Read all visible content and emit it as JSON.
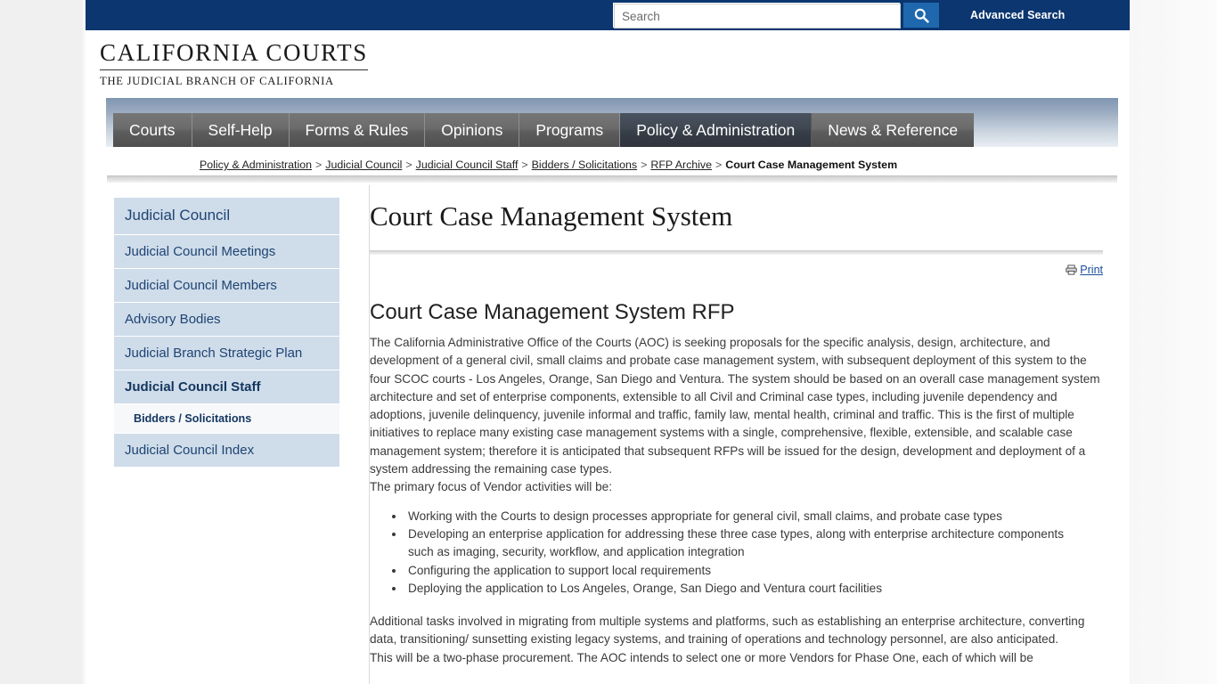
{
  "topbar": {
    "search_placeholder": "Search",
    "search_value": "",
    "search_icon": "search-icon",
    "advanced_search": "Advanced Search",
    "bar_color": "#0b3670",
    "button_color": "#1f68ad"
  },
  "logo": {
    "main": "CALIFORNIA COURTS",
    "sub": "THE JUDICIAL BRANCH OF CALIFORNIA"
  },
  "nav": {
    "tabs": [
      {
        "label": "Courts",
        "active": false
      },
      {
        "label": "Self-Help",
        "active": false
      },
      {
        "label": "Forms & Rules",
        "active": false
      },
      {
        "label": "Opinions",
        "active": false
      },
      {
        "label": "Programs",
        "active": false
      },
      {
        "label": "Policy & Administration",
        "active": true
      },
      {
        "label": "News & Reference",
        "active": false
      }
    ]
  },
  "breadcrumb": {
    "items": [
      "Policy & Administration",
      "Judicial Council",
      "Judicial Council Staff",
      "Bidders / Solicitations",
      "RFP Archive"
    ],
    "separator": ">",
    "current": "Court Case Management System"
  },
  "sidebar": {
    "items": [
      {
        "label": "Judicial Council",
        "type": "head"
      },
      {
        "label": "Judicial Council Meetings",
        "type": "item"
      },
      {
        "label": "Judicial Council Members",
        "type": "item"
      },
      {
        "label": "Advisory Bodies",
        "type": "item"
      },
      {
        "label": "Judicial Branch Strategic Plan",
        "type": "item"
      },
      {
        "label": "Judicial Council Staff",
        "type": "active"
      },
      {
        "label": "Bidders / Solicitations",
        "type": "sub"
      },
      {
        "label": "Judicial Council Index",
        "type": "item"
      }
    ]
  },
  "main": {
    "page_title": "Court Case Management System",
    "print_label": "Print",
    "print_icon": "printer-icon",
    "heading": "Court Case Management System RFP",
    "paragraph1": "The California Administrative Office of the Courts (AOC) is seeking proposals for the specific analysis, design, architecture, and development of a general civil, small claims and probate case management system, with subsequent deployment of this system to the four SCOC courts - Los Angeles, Orange, San Diego and Ventura. The system should be based on an overall case management system architecture and set of enterprise components, extensible to all Civil and Criminal case types, including juvenile dependency and adoptions, juvenile delinquency, juvenile informal and traffic, family law, mental health, criminal and traffic. This is the first of multiple initiatives to replace many existing case management systems with a single, comprehensive, flexible, extensible, and scalable case management system; therefore it is anticipated that subsequent RFPs will be issued for the design, development and deployment of a system addressing the remaining case types.",
    "paragraph2": "The primary focus of Vendor activities will be:",
    "bullets": [
      "Working with the Courts to design processes appropriate for general civil, small claims, and probate case types",
      "Developing an enterprise application for addressing these three case types, along with enterprise architecture components such as imaging, security, workflow, and application integration",
      "Configuring the application to support local requirements",
      "Deploying the application to Los Angeles, Orange, San Diego and Ventura court facilities"
    ],
    "paragraph3": "Additional tasks involved in migrating from multiple systems and platforms, such as establishing an enterprise architecture, converting data, transitioning/ sunsetting existing legacy systems, and training of operations and technology personnel, are also anticipated.",
    "paragraph4": "This will be a two-phase procurement. The AOC intends to select one or more Vendors for Phase One, each of which will be"
  }
}
